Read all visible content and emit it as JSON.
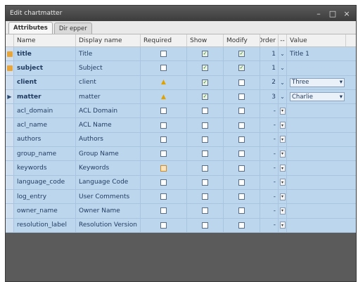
{
  "window": {
    "title": "Edit chartmatter"
  },
  "window_buttons": {
    "minimize": "–",
    "maximize": "□",
    "close": "×"
  },
  "tabs": [
    {
      "label": "Attributes",
      "active": true
    },
    {
      "label": "Dir epper",
      "active": false
    }
  ],
  "columns": {
    "name": "Name",
    "display": "Display name",
    "required": "Required",
    "show": "Show",
    "modify": "Modify",
    "order": "Order",
    "dd": "--",
    "value": "Value"
  },
  "rows": [
    {
      "name": "title",
      "bold": true,
      "display": "Title",
      "required": "box",
      "show": true,
      "modify": true,
      "order": "1",
      "value": "Title 1",
      "value_type": "text",
      "marker": "pk"
    },
    {
      "name": "subject",
      "bold": true,
      "display": "Subject",
      "required": "box",
      "show": true,
      "modify": true,
      "order": "1",
      "value": "",
      "value_type": "text",
      "marker": "pk"
    },
    {
      "name": "client",
      "bold": true,
      "display": "client",
      "required": "warn",
      "show": true,
      "modify": false,
      "order": "2",
      "value": "Three",
      "value_type": "select",
      "marker": ""
    },
    {
      "name": "matter",
      "bold": true,
      "display": "matter",
      "required": "warn",
      "show": true,
      "modify": false,
      "order": "3",
      "value": "Charlie",
      "value_type": "select",
      "marker": "arrow"
    },
    {
      "name": "acl_domain",
      "bold": false,
      "display": "ACL Domain",
      "required": "box",
      "show": false,
      "modify": false,
      "order": "-",
      "value": "",
      "value_type": "dd",
      "marker": ""
    },
    {
      "name": "acl_name",
      "bold": false,
      "display": "ACL Name",
      "required": "box",
      "show": false,
      "modify": false,
      "order": "-",
      "value": "",
      "value_type": "dd",
      "marker": ""
    },
    {
      "name": "authors",
      "bold": false,
      "display": "Authors",
      "required": "box",
      "show": false,
      "modify": false,
      "order": "-",
      "value": "",
      "value_type": "dd",
      "marker": ""
    },
    {
      "name": "group_name",
      "bold": false,
      "display": "Group Name",
      "required": "box",
      "show": false,
      "modify": false,
      "order": "-",
      "value": "",
      "value_type": "dd",
      "marker": ""
    },
    {
      "name": "keywords",
      "bold": false,
      "display": "Keywords",
      "required": "orange",
      "show": false,
      "modify": false,
      "order": "-",
      "value": "",
      "value_type": "dd",
      "marker": ""
    },
    {
      "name": "language_code",
      "bold": false,
      "display": "Language Code",
      "required": "box",
      "show": false,
      "modify": false,
      "order": "-",
      "value": "",
      "value_type": "dd",
      "marker": ""
    },
    {
      "name": "log_entry",
      "bold": false,
      "display": "User Comments",
      "required": "box",
      "show": false,
      "modify": false,
      "order": "-",
      "value": "",
      "value_type": "dd",
      "marker": ""
    },
    {
      "name": "owner_name",
      "bold": false,
      "display": "Owner Name",
      "required": "box",
      "show": false,
      "modify": false,
      "order": "-",
      "value": "",
      "value_type": "dd",
      "marker": ""
    },
    {
      "name": "resolution_label",
      "bold": false,
      "display": "Resolution Version",
      "required": "box",
      "show": false,
      "modify": false,
      "order": "-",
      "value": "",
      "value_type": "dd",
      "marker": ""
    }
  ]
}
